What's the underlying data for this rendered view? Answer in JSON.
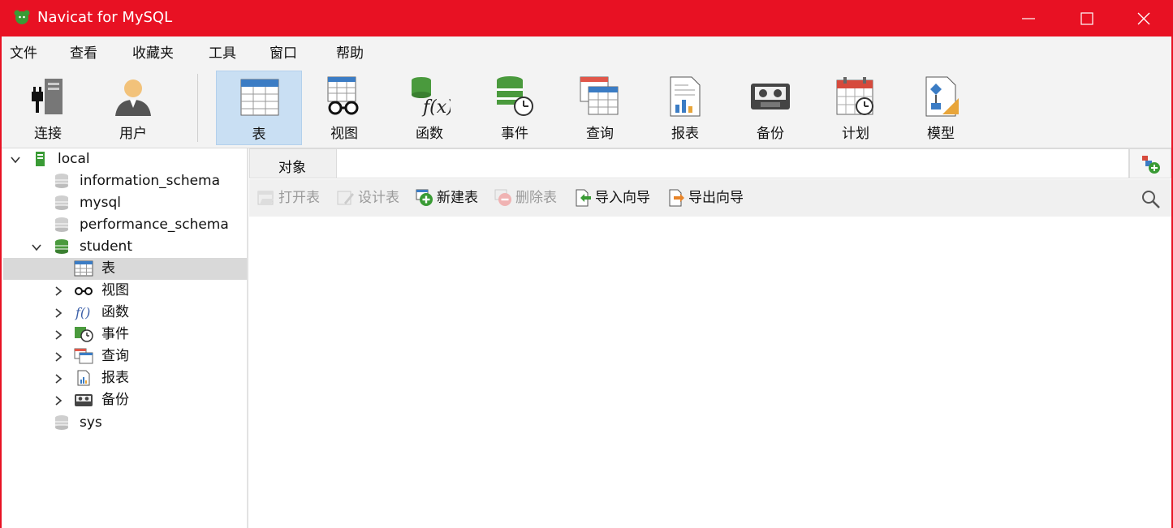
{
  "window": {
    "title": "Navicat for MySQL"
  },
  "colors": {
    "titlebar": "#e81123",
    "active_tool": "#c9dff3",
    "selected_row": "#d9d9d9"
  },
  "menu": [
    "文件",
    "查看",
    "收藏夹",
    "工具",
    "窗口",
    "帮助"
  ],
  "toolbar": [
    {
      "label": "连接",
      "icon": "plug-server-icon"
    },
    {
      "label": "用户",
      "icon": "user-icon"
    },
    {
      "label": "表",
      "icon": "table-icon",
      "active": true
    },
    {
      "label": "视图",
      "icon": "view-glasses-icon"
    },
    {
      "label": "函数",
      "icon": "function-icon"
    },
    {
      "label": "事件",
      "icon": "event-clock-icon"
    },
    {
      "label": "查询",
      "icon": "query-icon"
    },
    {
      "label": "报表",
      "icon": "report-icon"
    },
    {
      "label": "备份",
      "icon": "backup-tape-icon"
    },
    {
      "label": "计划",
      "icon": "schedule-calendar-icon"
    },
    {
      "label": "模型",
      "icon": "model-icon"
    }
  ],
  "tree": {
    "connection": "local",
    "databases": [
      "information_schema",
      "mysql",
      "performance_schema",
      "student",
      "sys"
    ],
    "student_children": [
      "表",
      "视图",
      "函数",
      "事件",
      "查询",
      "报表",
      "备份"
    ]
  },
  "objects_tab": {
    "label": "对象"
  },
  "object_toolbar": [
    {
      "label": "打开表",
      "enabled": false
    },
    {
      "label": "设计表",
      "enabled": false
    },
    {
      "label": "新建表",
      "enabled": true
    },
    {
      "label": "删除表",
      "enabled": false
    },
    {
      "label": "导入向导",
      "enabled": true
    },
    {
      "label": "导出向导",
      "enabled": true
    }
  ]
}
